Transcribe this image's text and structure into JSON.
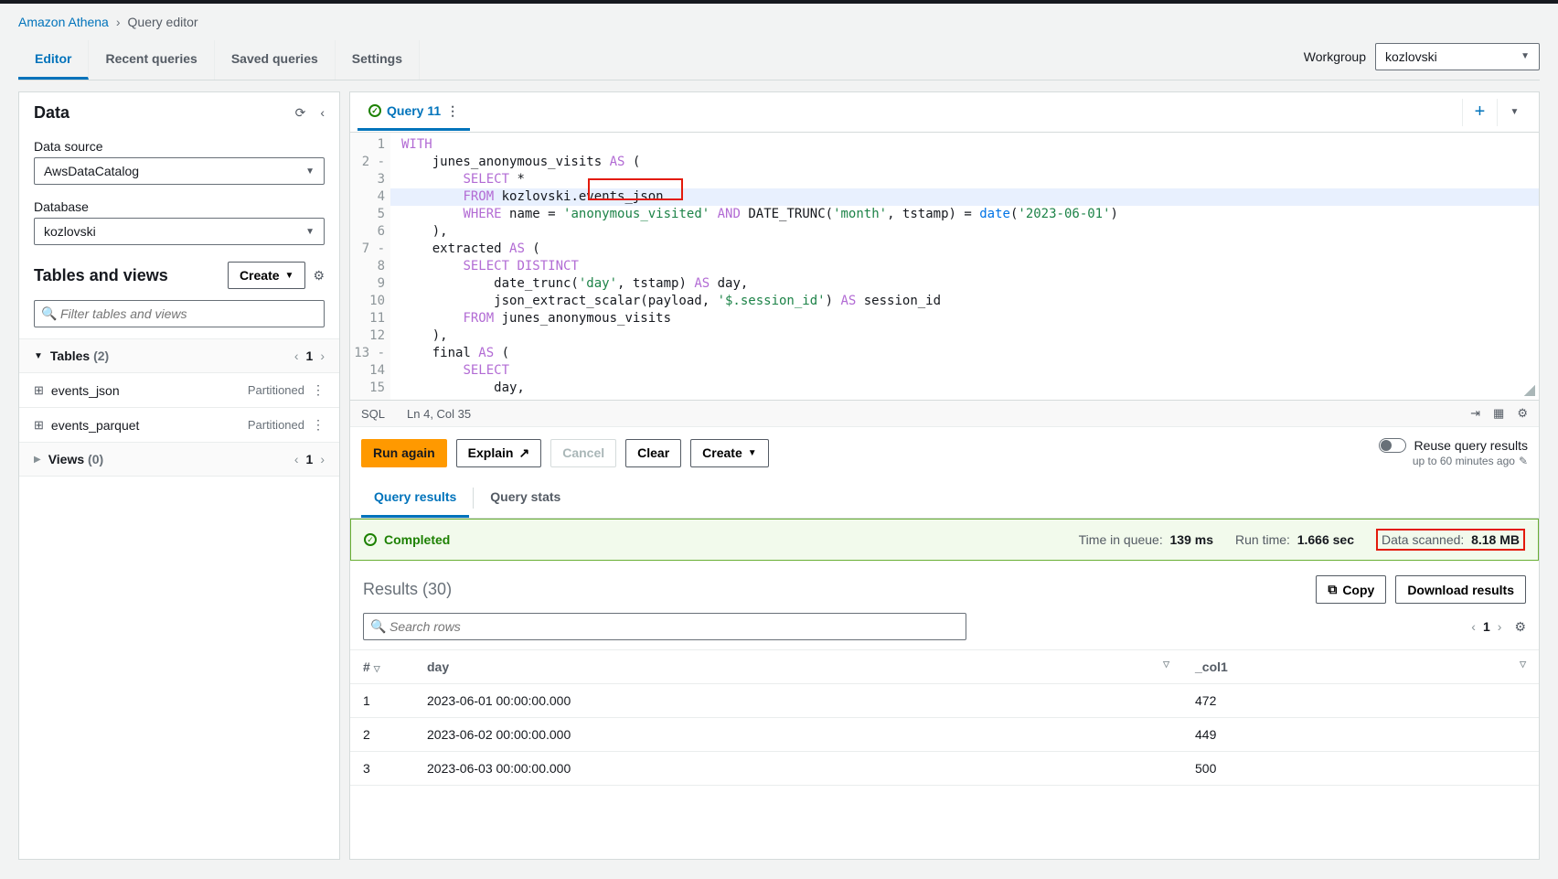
{
  "breadcrumb": {
    "service": "Amazon Athena",
    "current": "Query editor"
  },
  "top_tabs": {
    "editor": "Editor",
    "recent": "Recent queries",
    "saved": "Saved queries",
    "settings": "Settings"
  },
  "workgroup": {
    "label": "Workgroup",
    "value": "kozlovski"
  },
  "data_panel": {
    "title": "Data",
    "data_source_label": "Data source",
    "data_source_value": "AwsDataCatalog",
    "database_label": "Database",
    "database_value": "kozlovski",
    "tv_title": "Tables and views",
    "create_label": "Create",
    "filter_placeholder": "Filter tables and views",
    "tables_label": "Tables",
    "tables_count": "(2)",
    "views_label": "Views",
    "views_count": "(0)",
    "page": "1",
    "tables": [
      {
        "name": "events_json",
        "badge": "Partitioned"
      },
      {
        "name": "events_parquet",
        "badge": "Partitioned"
      }
    ]
  },
  "query_tab": {
    "name": "Query 11"
  },
  "editor": {
    "lines": {
      "l1": "WITH",
      "l2a": "    junes_anonymous_visits ",
      "l2b": "AS",
      "l2c": " (",
      "l3a": "        ",
      "l3b": "SELECT",
      "l3c": " *",
      "l4a": "        ",
      "l4b": "FROM",
      "l4c": " kozlovski.events_json",
      "l5a": "        ",
      "l5b": "WHERE",
      "l5c": " name = ",
      "l5d": "'anonymous_visited'",
      "l5e": " AND",
      "l5f": " DATE_TRUNC(",
      "l5g": "'month'",
      "l5h": ", tstamp) = ",
      "l5i": "date",
      "l5j": "(",
      "l5k": "'2023-06-01'",
      "l5l": ")",
      "l6": "    ),",
      "l7a": "    extracted ",
      "l7b": "AS",
      "l7c": " (",
      "l8a": "        ",
      "l8b": "SELECT DISTINCT",
      "l9a": "            date_trunc(",
      "l9b": "'day'",
      "l9c": ", tstamp) ",
      "l9d": "AS",
      "l9e": " day,",
      "l10a": "            json_extract_scalar(payload, ",
      "l10b": "'$.session_id'",
      "l10c": ") ",
      "l10d": "AS",
      "l10e": " session_id",
      "l11a": "        ",
      "l11b": "FROM",
      "l11c": " junes_anonymous_visits",
      "l12": "    ),",
      "l13a": "    final ",
      "l13b": "AS",
      "l13c": " (",
      "l14a": "        ",
      "l14b": "SELECT",
      "l15": "            day,"
    },
    "gutter": [
      "1",
      "2",
      "3",
      "4",
      "5",
      "6",
      "7",
      "8",
      "9",
      "10",
      "11",
      "12",
      "13",
      "14",
      "15"
    ],
    "fold": {
      "g2": "-",
      "g7": "-",
      "g13": "-"
    }
  },
  "statusbar": {
    "lang": "SQL",
    "pos": "Ln 4, Col 35"
  },
  "runbar": {
    "run": "Run again",
    "explain": "Explain",
    "cancel": "Cancel",
    "clear": "Clear",
    "create": "Create",
    "reuse_label": "Reuse query results",
    "reuse_sub": "up to 60 minutes ago"
  },
  "rtabs": {
    "results": "Query results",
    "stats": "Query stats"
  },
  "completed": {
    "label": "Completed",
    "queue_label": "Time in queue:",
    "queue_val": "139 ms",
    "run_label": "Run time:",
    "run_val": "1.666 sec",
    "scanned_label": "Data scanned:",
    "scanned_val": "8.18 MB"
  },
  "results": {
    "title": "Results",
    "count": "(30)",
    "copy": "Copy",
    "download": "Download results",
    "search_placeholder": "Search rows",
    "page": "1",
    "headers": {
      "idx": "#",
      "day": "day",
      "col1": "_col1"
    },
    "rows": [
      {
        "idx": "1",
        "day": "2023-06-01 00:00:00.000",
        "col1": "472"
      },
      {
        "idx": "2",
        "day": "2023-06-02 00:00:00.000",
        "col1": "449"
      },
      {
        "idx": "3",
        "day": "2023-06-03 00:00:00.000",
        "col1": "500"
      }
    ]
  }
}
